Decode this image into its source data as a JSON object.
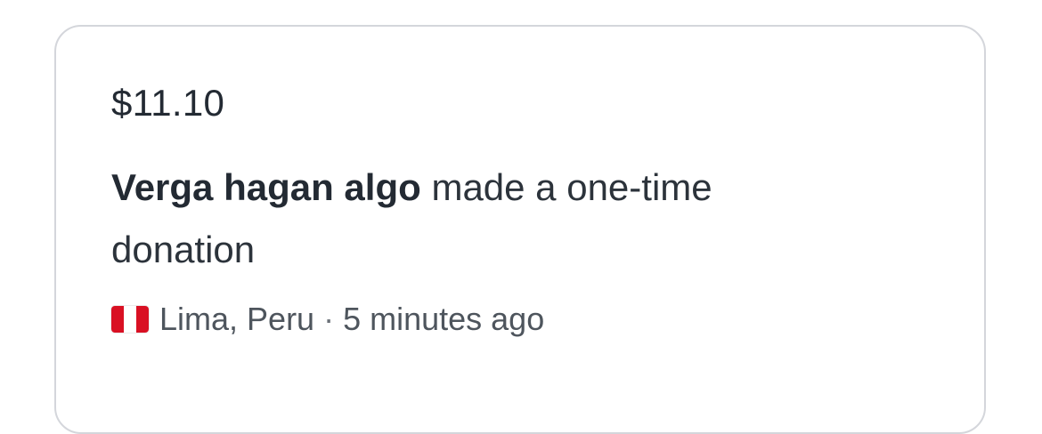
{
  "donation": {
    "amount": "$11.10",
    "donor_name": "Verga hagan algo",
    "message_rest": "made a one-time donation",
    "location": "Lima, Peru",
    "separator": "·",
    "time_ago": "5 minutes ago",
    "flag_icon": "peru-flag-icon",
    "flag_colors": [
      "#d91023",
      "#ffffff",
      "#d91023"
    ]
  }
}
